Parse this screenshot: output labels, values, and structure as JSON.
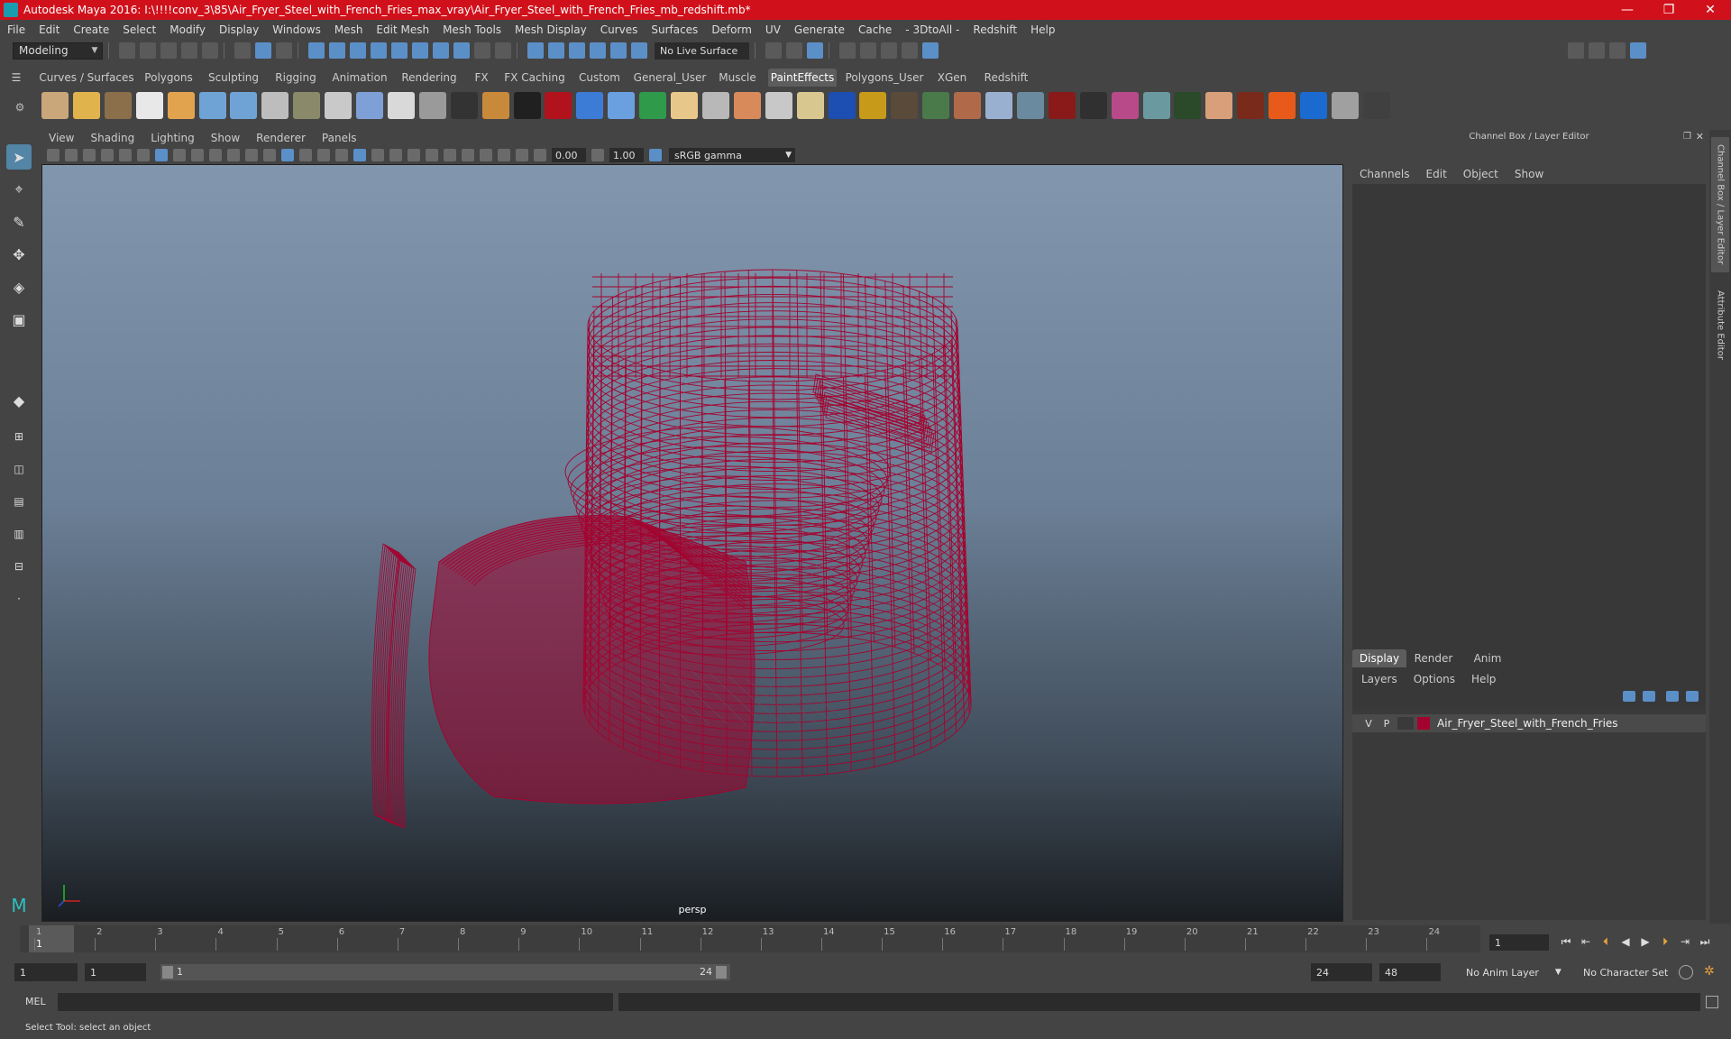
{
  "window": {
    "title": "Autodesk Maya 2016: I:\\!!!!conv_3\\85\\Air_Fryer_Steel_with_French_Fries_max_vray\\Air_Fryer_Steel_with_French_Fries_mb_redshift.mb*",
    "controls": [
      "—",
      "❐",
      "✕"
    ]
  },
  "menubar": [
    "File",
    "Edit",
    "Create",
    "Select",
    "Modify",
    "Display",
    "Windows",
    "Mesh",
    "Edit Mesh",
    "Mesh Tools",
    "Mesh Display",
    "Curves",
    "Surfaces",
    "Deform",
    "UV",
    "Generate",
    "Cache",
    "- 3DtoAll -",
    "Redshift",
    "Help"
  ],
  "statusline": {
    "mode": "Modeling",
    "live_surface": "No Live Surface"
  },
  "shelf": {
    "tabs": [
      "Curves / Surfaces",
      "Polygons",
      "Sculpting",
      "Rigging",
      "Animation",
      "Rendering",
      "FX",
      "FX Caching",
      "Custom",
      "General_User",
      "Muscle",
      "PaintEffects",
      "Polygons_User",
      "XGen",
      "Redshift"
    ],
    "active_tab": "PaintEffects",
    "icon_colors": [
      "#c9a77a",
      "#e0b34c",
      "#8a6f4a",
      "#e8e8e8",
      "#e2a34f",
      "#6fa3d6",
      "#6fa3d6",
      "#bdbdbd",
      "#8a8a6a",
      "#c9c9c9",
      "#7fa0d6",
      "#d9d9d9",
      "#9a9a9a",
      "#333333",
      "#c88a3a",
      "#202020",
      "#b2121c",
      "#3d7cd6",
      "#6aa0e0",
      "#2f9a4a",
      "#e8c88a",
      "#b8b8b8",
      "#d88a5a",
      "#c8c8c8",
      "#d8c890",
      "#1d4fb2",
      "#c89a1a",
      "#5a4a3a",
      "#4a7a4a",
      "#b06a4a",
      "#9ab0d0",
      "#6a8aa0",
      "#8a1a1a",
      "#303030",
      "#b84a8a",
      "#6a9aa0",
      "#2a4a2a",
      "#d8a07a",
      "#7a2a1a",
      "#e85a1a",
      "#1a6ad0",
      "#a0a0a0",
      "#404040"
    ]
  },
  "toolbox": {
    "tools": [
      "select-tool",
      "lasso-tool",
      "paint-select-tool",
      "move-tool",
      "rotate-tool",
      "scale-tool"
    ]
  },
  "viewport": {
    "menu": [
      "View",
      "Shading",
      "Lighting",
      "Show",
      "Renderer",
      "Panels"
    ],
    "exposure": "0.00",
    "gamma": "1.00",
    "color_space": "sRGB gamma",
    "camera": "persp",
    "wire_color": "#a3042f"
  },
  "channel_box": {
    "header": "Channel Box / Layer Editor",
    "menu": [
      "Channels",
      "Edit",
      "Object",
      "Show"
    ]
  },
  "layer_editor": {
    "tabs": [
      "Display",
      "Render",
      "Anim"
    ],
    "active_tab": "Display",
    "menu": [
      "Layers",
      "Options",
      "Help"
    ],
    "layer": {
      "v": "V",
      "p": "P",
      "name": "Air_Fryer_Steel_with_French_Fries",
      "color": "#a3042f"
    }
  },
  "side_tabs": [
    "Channel Box / Layer Editor",
    "Attribute Editor"
  ],
  "timeline": {
    "ticks": [
      "1",
      "2",
      "3",
      "4",
      "5",
      "6",
      "7",
      "8",
      "9",
      "10",
      "11",
      "12",
      "13",
      "14",
      "15",
      "16",
      "17",
      "18",
      "19",
      "20",
      "21",
      "22",
      "23",
      "24"
    ],
    "current_frame": "1",
    "frame_field": "1"
  },
  "range": {
    "start": "1",
    "playback_start": "1",
    "range_start_label": "1",
    "range_end_label": "24",
    "playback_end": "24",
    "end": "48",
    "anim_layer": "No Anim Layer",
    "character_set": "No Character Set"
  },
  "command_line": {
    "label": "MEL"
  },
  "help_line": "Select Tool: select an object"
}
